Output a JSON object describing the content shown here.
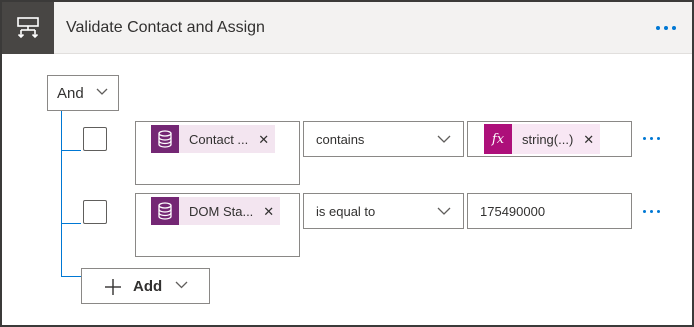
{
  "header": {
    "title": "Validate Contact and Assign",
    "icon": "condition-icon",
    "more_icon": "more-options-icon"
  },
  "group": {
    "logic_operator": "And"
  },
  "rows": [
    {
      "operand_token": "Contact ...",
      "operand_icon": "dataverse-icon",
      "operator": "contains",
      "value_token": "string(...)",
      "value_icon": "fx-expression-icon",
      "value_text": ""
    },
    {
      "operand_token": "DOM Sta...",
      "operand_icon": "dataverse-icon",
      "operator": "is equal to",
      "value_token": "",
      "value_text": "175490000"
    }
  ],
  "add": {
    "label": "Add"
  },
  "colors": {
    "accent": "#0078d4",
    "header_bg": "#f3f2f1",
    "header_icon_bg": "#484644",
    "dataverse_token_icon_bg": "#742774",
    "fx_token_icon_bg": "#ad0f7a",
    "token_bg": "#f3e5f0"
  }
}
